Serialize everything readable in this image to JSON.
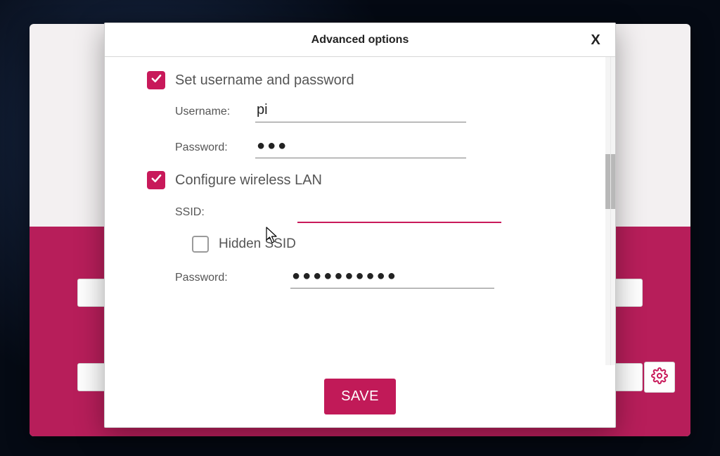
{
  "colors": {
    "accent": "#c8195a"
  },
  "dialog": {
    "title": "Advanced options",
    "close_glyph": "X",
    "save_label": "SAVE"
  },
  "sections": {
    "user": {
      "checked": true,
      "title": "Set username and password",
      "username_label": "Username:",
      "username_value": "pi",
      "password_label": "Password:",
      "password_masked": "●●●"
    },
    "wlan": {
      "checked": true,
      "title": "Configure wireless LAN",
      "ssid_label": "SSID:",
      "ssid_value": "",
      "hidden_checked": false,
      "hidden_label": "Hidden SSID",
      "password_label": "Password:",
      "password_masked": "●●●●●●●●●●"
    }
  }
}
